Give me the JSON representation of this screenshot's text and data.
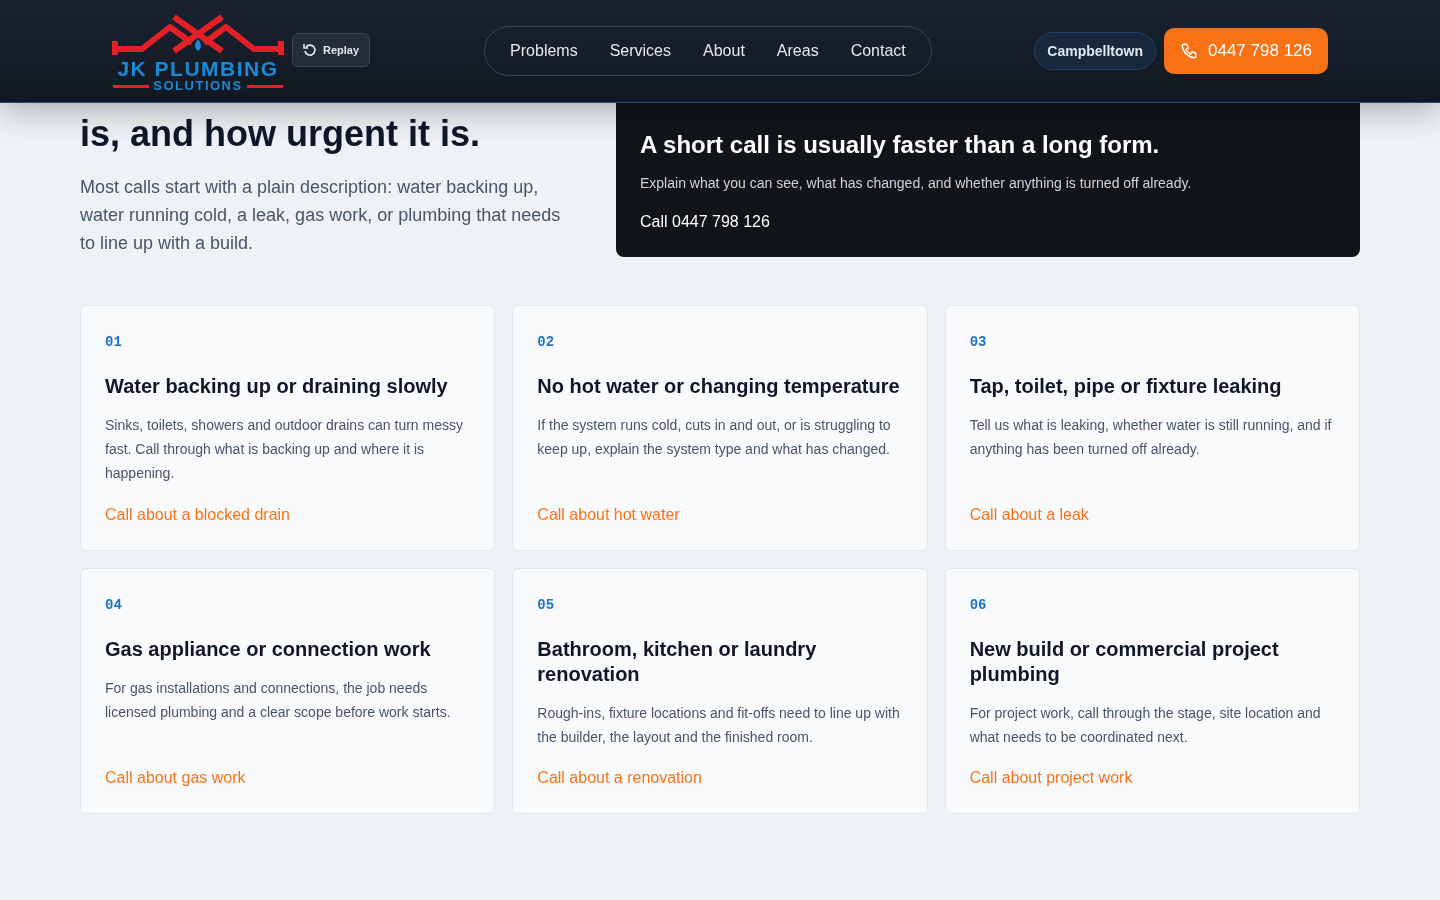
{
  "header": {
    "logo": {
      "name": "JK PLUMBING",
      "tagline": "SOLUTIONS"
    },
    "replay_button": "Replay",
    "nav": [
      {
        "label": "Problems"
      },
      {
        "label": "Services"
      },
      {
        "label": "About"
      },
      {
        "label": "Areas"
      },
      {
        "label": "Contact"
      }
    ],
    "location": "Campbelltown",
    "phone_button": "0447 798 126"
  },
  "hero": {
    "heading_lines": [
      "is, and how urgent it is."
    ],
    "intro": "Most calls start with a plain description: water backing up, water running cold, a leak, gas work, or plumbing that needs to line up with a build."
  },
  "advice_card": {
    "title": "A short call is usually faster than a long form.",
    "text": "Explain what you can see, what has changed, and whether anything is turned off already.",
    "link": "Call 0447 798 126"
  },
  "problems": [
    {
      "number": "01",
      "title": "Water backing up or draining slowly",
      "text": "Sinks, toilets, showers and outdoor drains can turn messy fast. Call through what is backing up and where it is happening.",
      "link": "Call about a blocked drain"
    },
    {
      "number": "02",
      "title": "No hot water or changing temperature",
      "text": "If the system runs cold, cuts in and out, or is struggling to keep up, explain the system type and what has changed.",
      "link": "Call about hot water"
    },
    {
      "number": "03",
      "title": "Tap, toilet, pipe or fixture leaking",
      "text": "Tell us what is leaking, whether water is still running, and if anything has been turned off already.",
      "link": "Call about a leak"
    },
    {
      "number": "04",
      "title": "Gas appliance or connection work",
      "text": "For gas installations and connections, the job needs licensed plumbing and a clear scope before work starts.",
      "link": "Call about gas work"
    },
    {
      "number": "05",
      "title": "Bathroom, kitchen or laundry renovation",
      "text": "Rough-ins, fixture locations and fit-offs need to line up with the builder, the layout and the finished room.",
      "link": "Call about a renovation"
    },
    {
      "number": "06",
      "title": "New build or commercial project plumbing",
      "text": "For project work, call through the stage, site location and what needs to be coordinated next.",
      "link": "Call about project work"
    }
  ]
}
